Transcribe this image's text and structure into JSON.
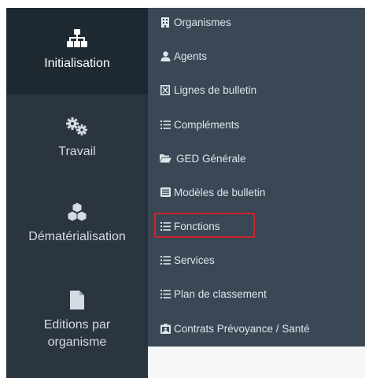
{
  "sidebar": {
    "items": [
      {
        "label": "Initialisation",
        "icon": "sitemap-icon",
        "active": true
      },
      {
        "label": "Travail",
        "icon": "gears-icon",
        "active": false
      },
      {
        "label": "Dématérialisation",
        "icon": "cubes-icon",
        "active": false
      },
      {
        "label_line1": "Editions par",
        "label_line2": "organisme",
        "icon": "file-icon",
        "active": false
      }
    ]
  },
  "submenu": {
    "items": [
      {
        "label": "Organismes",
        "icon": "building-icon"
      },
      {
        "label": "Agents",
        "icon": "user-icon"
      },
      {
        "label": "Lignes de bulletin",
        "icon": "list-box-icon"
      },
      {
        "label": "Compléments",
        "icon": "list-icon"
      },
      {
        "label": "GED Générale",
        "icon": "folder-open-icon"
      },
      {
        "label": "Modèles de bulletin",
        "icon": "template-icon"
      },
      {
        "label": "Fonctions",
        "icon": "list-icon",
        "highlighted": true
      },
      {
        "label": "Services",
        "icon": "list-icon"
      },
      {
        "label": "Plan de classement",
        "icon": "list-icon"
      },
      {
        "label": "Contrats Prévoyance / Santé",
        "icon": "id-card-icon"
      }
    ]
  },
  "colors": {
    "sidebar_bg": "#2a3540",
    "sidebar_active_bg": "#1f2932",
    "submenu_bg": "#3a4755",
    "highlight_border": "#d0232c"
  }
}
